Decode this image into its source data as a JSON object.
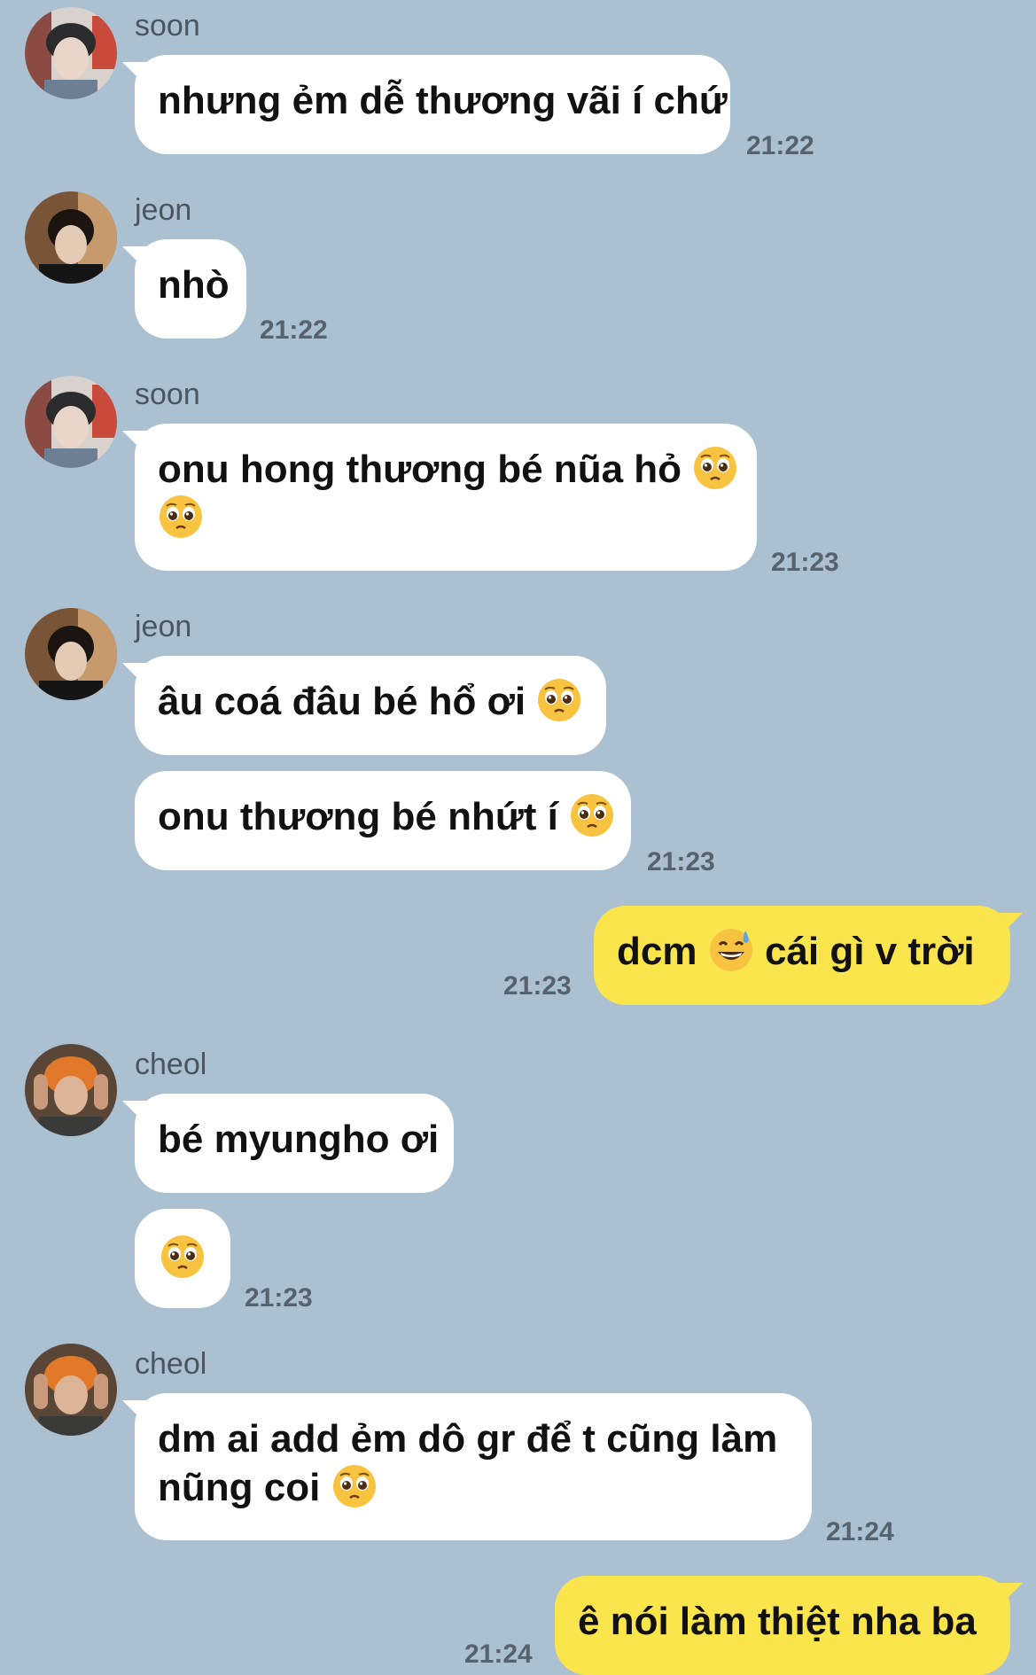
{
  "messages": [
    {
      "sender": "soon",
      "text": "nhưng ẻm dễ thương vãi í chứ",
      "time": "21:22"
    },
    {
      "sender": "jeon",
      "text": "nhò",
      "time": "21:22"
    },
    {
      "sender": "soon",
      "text_line1": "onu hong thương bé nũa hỏ",
      "emoji": "pleading-face",
      "time": "21:23"
    },
    {
      "sender": "jeon",
      "text1": "âu coá đâu bé hổ ơi",
      "text2": "onu thương bé nhứt í",
      "emoji": "pleading-face",
      "time": "21:23"
    },
    {
      "sender": "me",
      "text_a": "dcm",
      "text_b": "cái gì v trời",
      "emoji": "grinning-sweat-face",
      "time": "21:23"
    },
    {
      "sender": "cheol",
      "text1": "bé myungho ơi",
      "emoji": "pleading-face",
      "time": "21:23"
    },
    {
      "sender": "cheol",
      "text_line1": "dm ai add ẻm dô gr để t cũng làm",
      "text_line2": "nũng coi",
      "emoji": "pleading-face",
      "time": "21:24"
    },
    {
      "sender": "me",
      "text": "ê nói làm thiệt nha ba",
      "time": "21:24"
    }
  ],
  "colors": {
    "background": "#abc1d1",
    "incoming_bubble": "#ffffff",
    "outgoing_bubble": "#fae54d"
  }
}
